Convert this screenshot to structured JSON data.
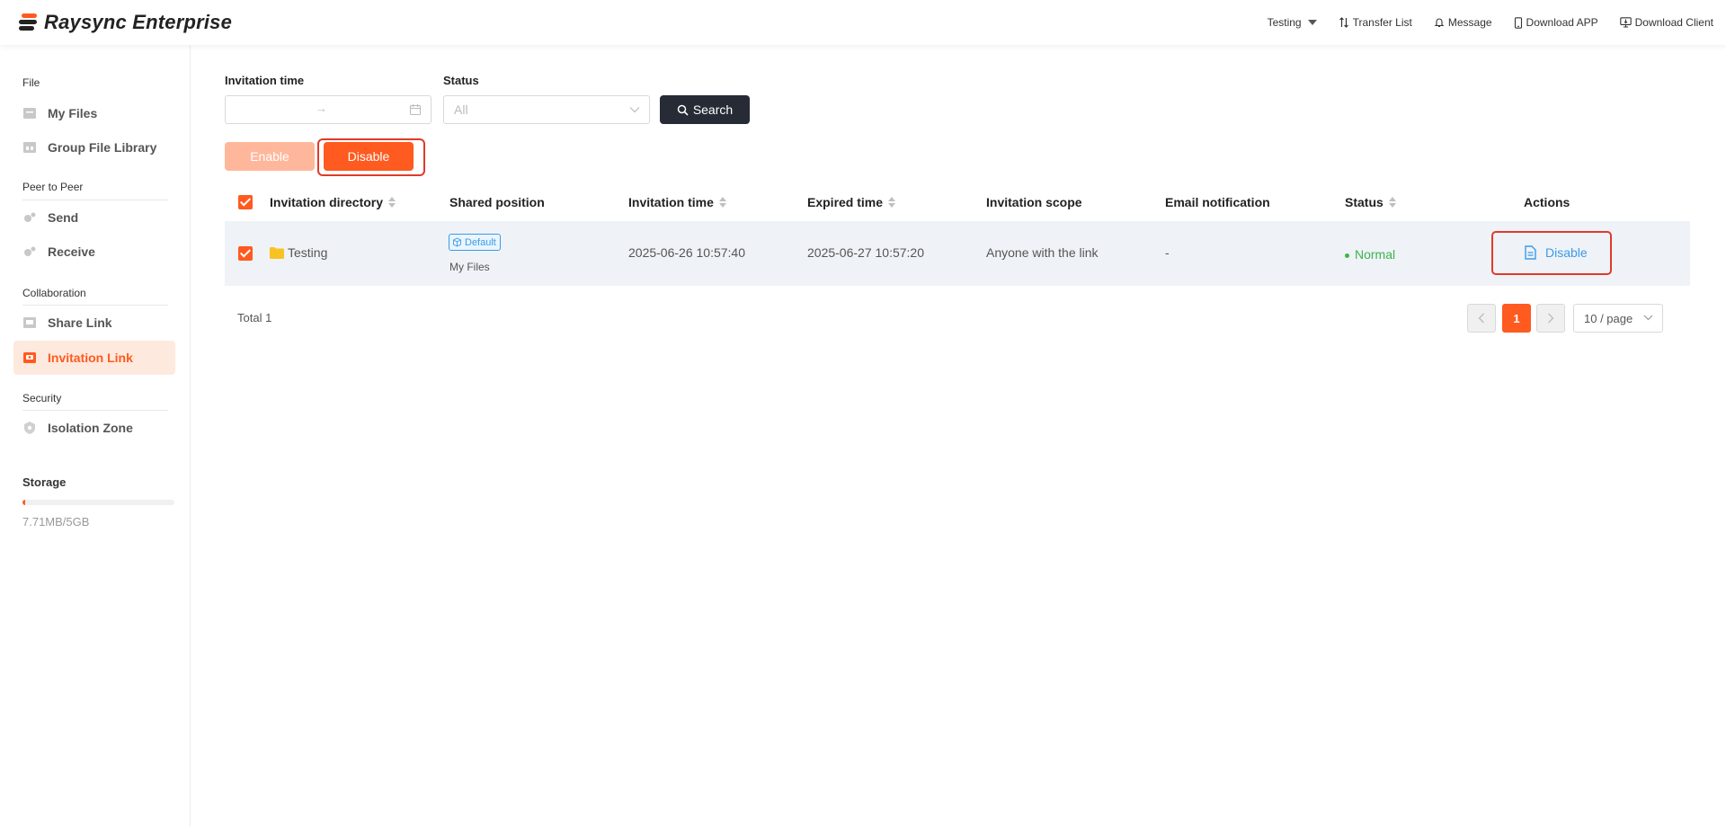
{
  "app": {
    "title": "Raysync Enterprise"
  },
  "header": {
    "user": "Testing",
    "transfer_list": "Transfer List",
    "message": "Message",
    "download_app": "Download APP",
    "download_client": "Download Client"
  },
  "sidebar": {
    "sections": [
      {
        "label": "File",
        "items": [
          {
            "label": "My Files",
            "icon": "folder-icon"
          },
          {
            "label": "Group File Library",
            "icon": "library-icon"
          }
        ]
      },
      {
        "label": "Peer to Peer",
        "items": [
          {
            "label": "Send",
            "icon": "send-icon"
          },
          {
            "label": "Receive",
            "icon": "receive-icon"
          }
        ]
      },
      {
        "label": "Collaboration",
        "items": [
          {
            "label": "Share Link",
            "icon": "share-link-icon"
          },
          {
            "label": "Invitation Link",
            "icon": "invitation-link-icon",
            "active": true
          }
        ]
      },
      {
        "label": "Security",
        "items": [
          {
            "label": "Isolation Zone",
            "icon": "shield-icon"
          }
        ]
      }
    ],
    "storage": {
      "label": "Storage",
      "used_text": "7.71MB/5GB",
      "used_fraction": 0.0015
    }
  },
  "filters": {
    "invitation_time_label": "Invitation time",
    "status_label": "Status",
    "status_placeholder": "All",
    "search_label": "Search"
  },
  "bulk_actions": {
    "enable_label": "Enable",
    "disable_label": "Disable"
  },
  "table": {
    "columns": {
      "directory": "Invitation directory",
      "shared_position": "Shared position",
      "invitation_time": "Invitation time",
      "expired_time": "Expired time",
      "scope": "Invitation scope",
      "email": "Email notification",
      "status": "Status",
      "actions": "Actions"
    },
    "rows": [
      {
        "directory": "Testing",
        "shared_tag": "Default",
        "shared_position": "My Files",
        "invitation_time": "2025-06-26 10:57:40",
        "expired_time": "2025-06-27 10:57:20",
        "scope": "Anyone with the link",
        "email": "-",
        "status": "Normal",
        "action": "Disable"
      }
    ]
  },
  "pagination": {
    "total": "Total 1",
    "current": "1",
    "page_size": "10 / page"
  },
  "colors": {
    "accent": "#ff5a1f",
    "link": "#3b9be8",
    "success": "#3bb54a",
    "dark_button": "#262b36"
  }
}
